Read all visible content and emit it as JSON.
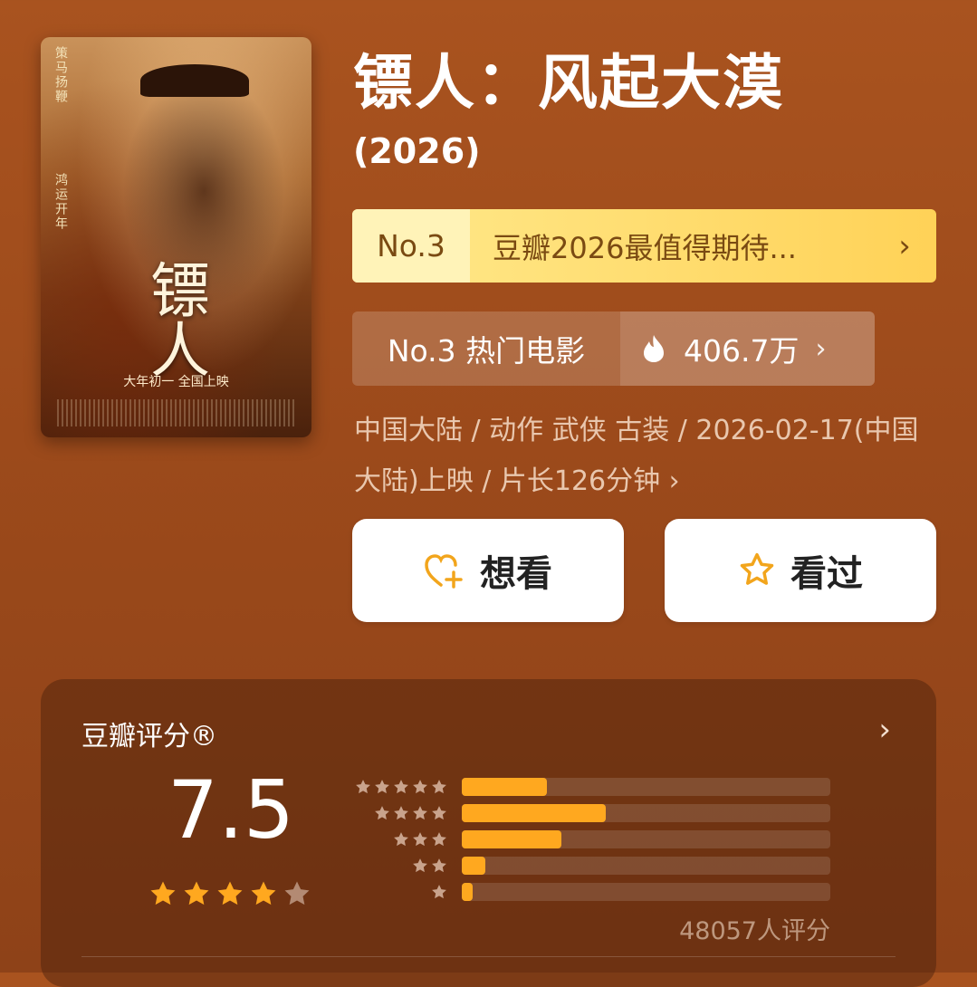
{
  "poster": {
    "side_text_left": "策马扬鞭",
    "side_text_right": "鸿运开年",
    "title": "镖人",
    "release": "大年初一 全国上映"
  },
  "movie": {
    "title": "镖人：风起大漠",
    "year": "(2026)"
  },
  "ranking": {
    "number": "No.3",
    "text": "豆瓣2026最值得期待..."
  },
  "hot": {
    "label": "No.3 热门电影",
    "count": "406.7万"
  },
  "meta": {
    "line": "中国大陆 / 动作 武侠 古装 / 2026-02-17(中国大陆)上映 / 片长126分钟 ›"
  },
  "actions": {
    "want": "想看",
    "seen": "看过"
  },
  "rating": {
    "label": "豆瓣评分®",
    "score": "7.5",
    "stars": 3.75,
    "count_text": "48057人评分",
    "distribution": [
      {
        "stars": 5,
        "fraction": 0.23
      },
      {
        "stars": 4,
        "fraction": 0.39
      },
      {
        "stars": 3,
        "fraction": 0.27
      },
      {
        "stars": 2,
        "fraction": 0.065
      },
      {
        "stars": 1,
        "fraction": 0.03
      }
    ]
  },
  "colors": {
    "accent": "#ffa81f",
    "background": "#a14e1d",
    "ranking_bar": "#ffd75e"
  }
}
